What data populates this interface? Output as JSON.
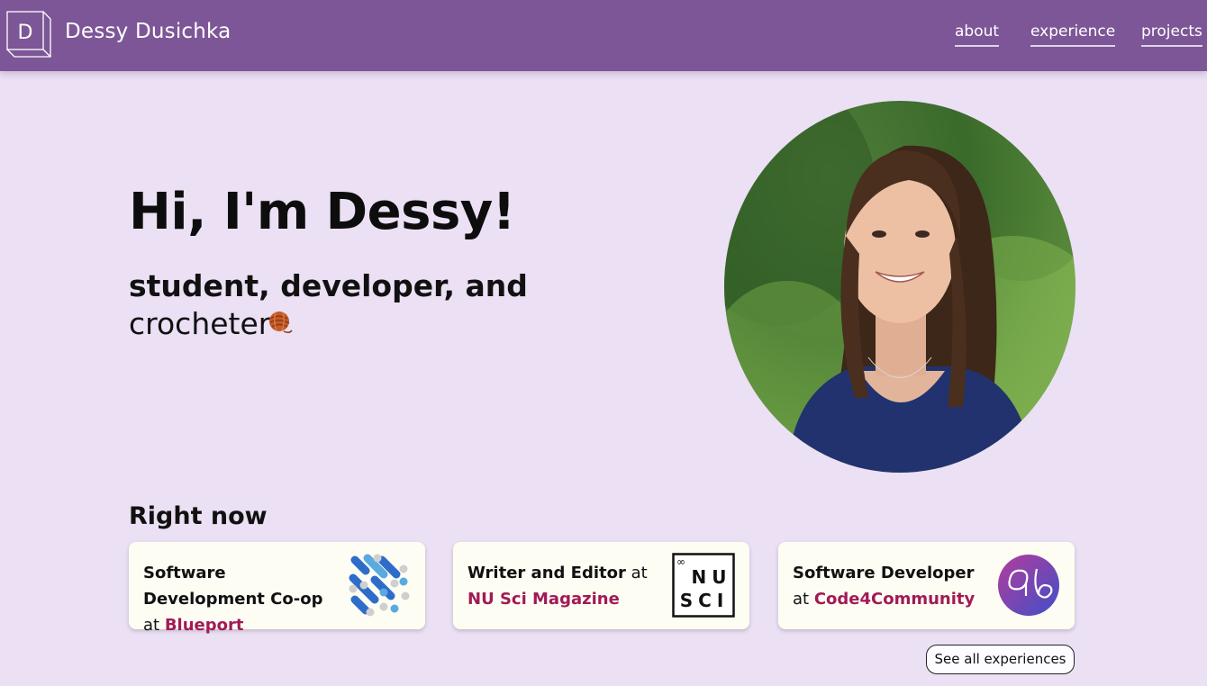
{
  "header": {
    "logo_letter": "D",
    "site_name": "Dessy Dusichka",
    "nav": [
      {
        "label": "about"
      },
      {
        "label": "experience"
      },
      {
        "label": "projects"
      }
    ]
  },
  "hero": {
    "title": "Hi, I'm Dessy!",
    "subtitle_bold": "student, developer, and",
    "subtitle_plain": "crocheter",
    "emoji_icon": "yarn-ball-icon"
  },
  "right_now": {
    "title": "Right now",
    "cards": [
      {
        "role": "Software Development Co-op",
        "at": "at",
        "org": "Blueport",
        "logo_icon": "blueport-logo-icon"
      },
      {
        "role": "Writer and Editor",
        "at": "at",
        "org": "NU Sci Magazine",
        "logo_icon": "nusci-logo-icon",
        "logo_text_top": "NU",
        "logo_text_bottom": "SCI",
        "logo_mark": "∞"
      },
      {
        "role": "Software Developer",
        "at": "at",
        "org": "Code4Community",
        "logo_icon": "code4community-logo-icon"
      }
    ],
    "see_all_label": "See all experiences"
  },
  "colors": {
    "header_bg": "#7d5697",
    "page_bg": "#ebe0f4",
    "card_bg": "#fdfdf4",
    "accent": "#a21a55"
  }
}
